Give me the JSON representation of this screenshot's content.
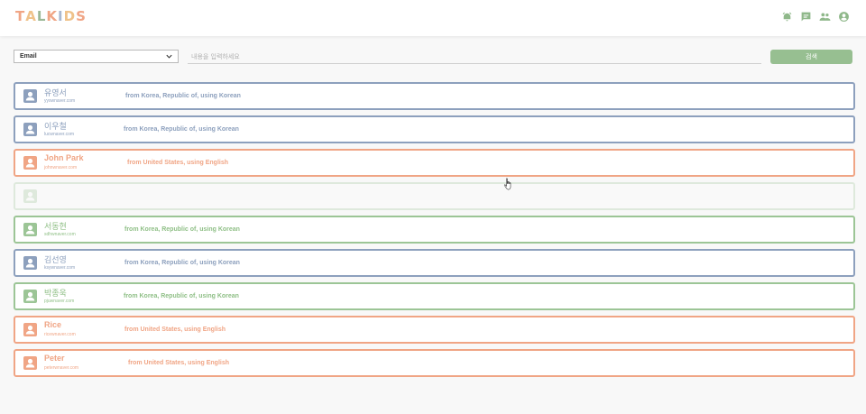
{
  "app": {
    "logo_letters": [
      {
        "char": "T",
        "color": "#f0a585"
      },
      {
        "char": "A",
        "color": "#efc28a"
      },
      {
        "char": "L",
        "color": "#9ab896"
      },
      {
        "char": "K",
        "color": "#f0a585"
      },
      {
        "char": "I",
        "color": "#a9b8d0"
      },
      {
        "char": "D",
        "color": "#efc28a"
      },
      {
        "char": "S",
        "color": "#f0a585"
      }
    ],
    "header_icons": [
      "alarm-icon",
      "chat-icon",
      "people-icon",
      "account-icon"
    ]
  },
  "search": {
    "field_selected": "Email",
    "placeholder": "내용을 입력하세요",
    "button_label": "검색"
  },
  "colors": {
    "blue": "#8da0bd",
    "orange": "#f0a585",
    "green": "#9cc596",
    "green_text": "#8fbf86"
  },
  "users": [
    {
      "name": "유영서",
      "email": "yyswnaver.com",
      "info": "from Korea, Republic of, using Korean",
      "theme": "blue"
    },
    {
      "name": "이우철",
      "email": "lucwnaver.com",
      "info": "from Korea, Republic of, using Korean",
      "theme": "blue"
    },
    {
      "name": "John Park",
      "email": "johnwnaver.com",
      "info": "from United States, using English",
      "theme": "orange"
    },
    {
      "name": "",
      "email": "",
      "info": "",
      "theme": "green"
    },
    {
      "name": "서동현",
      "email": "sdhwnaver.com",
      "info": "from Korea, Republic of, using Korean",
      "theme": "green"
    },
    {
      "name": "김선영",
      "email": "ksywnaver.com",
      "info": "from Korea, Republic of, using Korean",
      "theme": "blue"
    },
    {
      "name": "박종욱",
      "email": "pjuwnaver.com",
      "info": "from Korea, Republic of, using Korean",
      "theme": "green"
    },
    {
      "name": "Rice",
      "email": "ricewnaver.com",
      "info": "from United States, using English",
      "theme": "orange"
    },
    {
      "name": "Peter",
      "email": "peterwnaver.com",
      "info": "from United States, using English",
      "theme": "orange"
    }
  ]
}
